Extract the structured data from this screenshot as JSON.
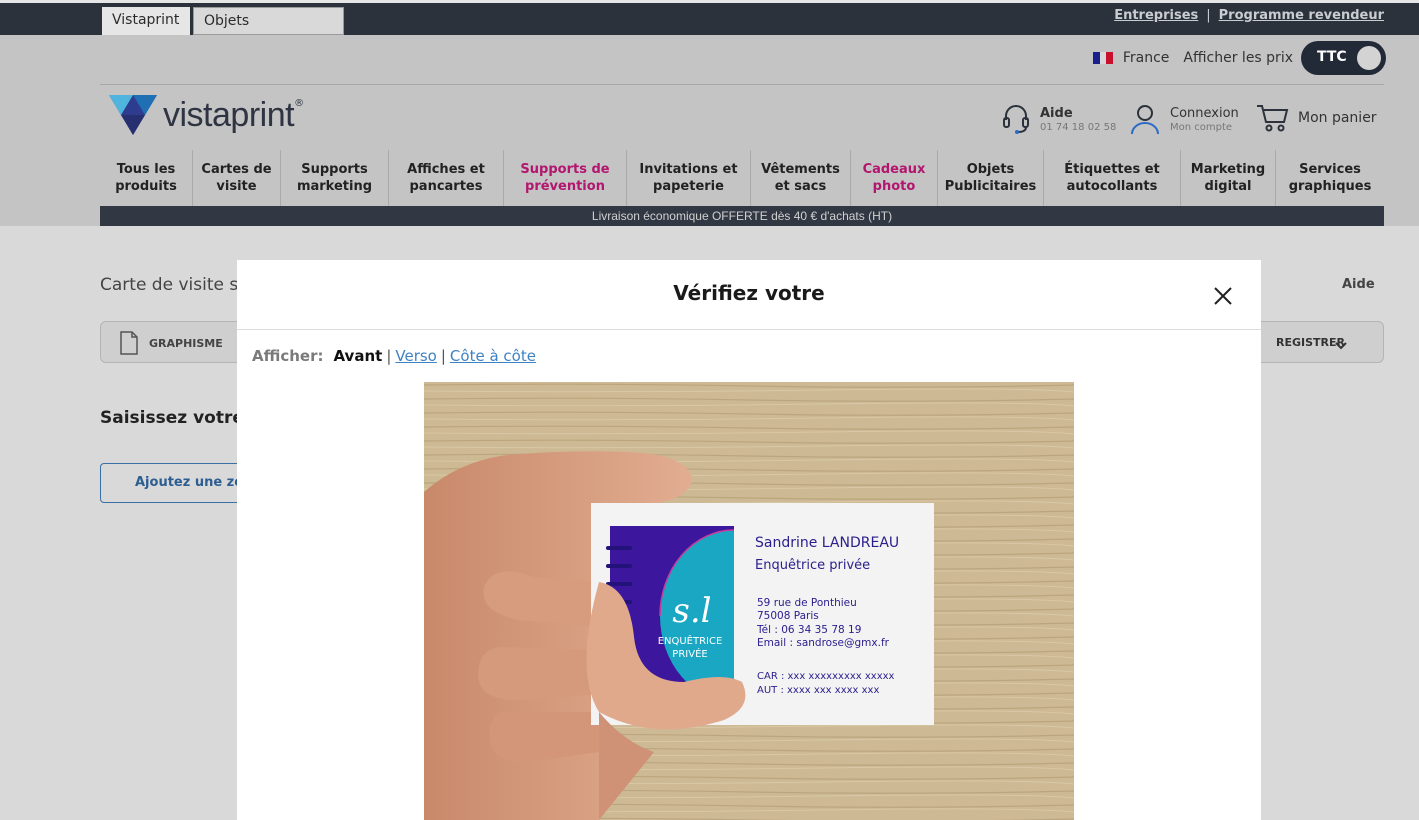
{
  "topbar": {
    "tabs": [
      "Vistaprint",
      "Objets Publicitaires"
    ],
    "links": [
      "Entreprises",
      "Programme revendeur"
    ]
  },
  "header": {
    "country": "France",
    "prices_label": "Afficher les prix",
    "toggle_label": "TTC",
    "logo_text": "vistaprint",
    "logo_mark": "®",
    "aide": {
      "title": "Aide",
      "phone": "01 74 18 02 58"
    },
    "connexion": {
      "title": "Connexion",
      "sub": "Mon compte"
    },
    "panier": "Mon panier"
  },
  "nav": [
    {
      "l1": "Tous les",
      "l2": "produits"
    },
    {
      "l1": "Cartes de",
      "l2": "visite"
    },
    {
      "l1": "Supports",
      "l2": "marketing"
    },
    {
      "l1": "Affiches et",
      "l2": "pancartes"
    },
    {
      "l1": "Supports de",
      "l2": "prévention"
    },
    {
      "l1": "Invitations et",
      "l2": "papeterie"
    },
    {
      "l1": "Vêtements",
      "l2": "et sacs"
    },
    {
      "l1": "Cadeaux",
      "l2": "photo"
    },
    {
      "l1": "Objets",
      "l2": "Publicitaires"
    },
    {
      "l1": "Étiquettes et",
      "l2": "autocollants"
    },
    {
      "l1": "Marketing",
      "l2": "digital"
    },
    {
      "l1": "Services",
      "l2": "graphiques"
    }
  ],
  "promo": "Livraison économique OFFERTE dès 40 € d'achats (HT)",
  "page": {
    "title": "Carte de visite s",
    "aide": "Aide",
    "graphisme": "GRAPHISME",
    "registrer": "REGISTRER",
    "saisissez": "Saisissez votre t",
    "ajoutez": "Ajoutez une zon"
  },
  "modal": {
    "title": "Vérifiez votre",
    "view_label": "Afficher:",
    "view_active": "Avant",
    "view_links": [
      "Verso",
      "Côte à côte"
    ]
  },
  "card": {
    "monogram": "s.l",
    "badge_l1": "ENQUÊTRICE",
    "badge_l2": "PRIVÉE",
    "name": "Sandrine LANDREAU",
    "role": "Enquêtrice privée",
    "address1": "59 rue de Ponthieu",
    "address2": "75008 Paris",
    "tel": "Tél : 06 34 35 78 19",
    "email": "Email : sandrose@gmx.fr",
    "car": "CAR : xxx xxxxxxxxx xxxxx",
    "aut": "AUT : xxxx xxx xxxx xxx"
  },
  "colors": {
    "topbar": "#2b323c",
    "accent_pink": "#b2166e",
    "card_purple": "#3d169e",
    "card_teal": "#1aa7c4",
    "link_blue": "#3f82c4"
  }
}
